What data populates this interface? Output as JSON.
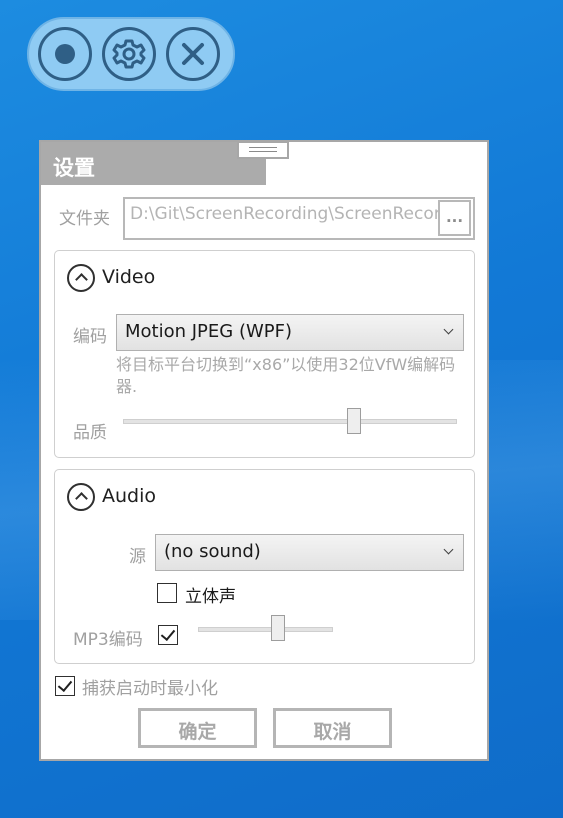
{
  "colors": {
    "desktop": "#1279d6",
    "pill": "#8fcbf3",
    "pill_icon": "#2f5f86",
    "title_bar": "#ababab",
    "muted_text": "#a0a0a0"
  },
  "toolbar": {
    "record_icon": "record-icon",
    "settings_icon": "gear-icon",
    "close_icon": "close-icon"
  },
  "settings": {
    "title": "设置",
    "folder_label": "文件夹",
    "folder_path": "D:\\Git\\ScreenRecording\\ScreenRecording",
    "browse_label": "...",
    "video": {
      "title": "Video",
      "codec_label": "编码",
      "codec_value": "Motion JPEG (WPF)",
      "codec_hint": "将目标平台切换到“x86”以使用32位VfW编解码器.",
      "quality_label": "品质",
      "quality_level": 0.7
    },
    "audio": {
      "title": "Audio",
      "source_label": "源",
      "source_value": "(no sound)",
      "stereo_label": "立体声",
      "stereo_checked": false,
      "mp3_label": "MP3编码",
      "mp3_checked": true,
      "mp3_quality_level": 0.6
    },
    "minimize_label": "捕获启动时最小化",
    "minimize_checked": true,
    "ok_label": "确定",
    "cancel_label": "取消"
  }
}
